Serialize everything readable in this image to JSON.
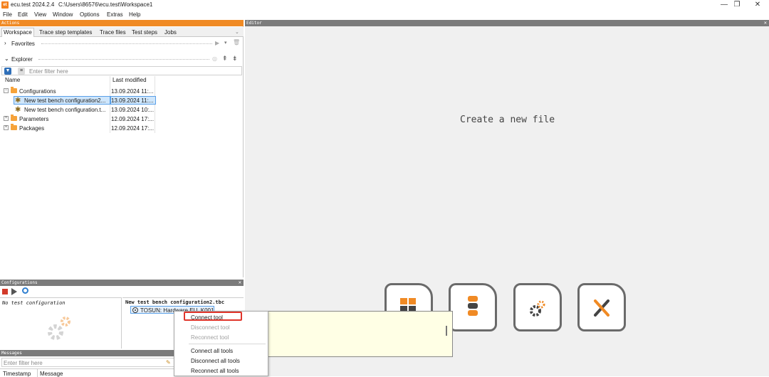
{
  "titlebar": {
    "app_icon": "et",
    "title": "ecu.test 2024.2.4",
    "path": "C:\\Users\\86576\\ecu.test\\Workspace1",
    "controls": {
      "minimize": "—",
      "maximize": "❐",
      "close": "✕"
    }
  },
  "menubar": {
    "items": [
      {
        "label": "File"
      },
      {
        "label": "Edit"
      },
      {
        "label": "View"
      },
      {
        "label": "Window"
      },
      {
        "label": "Options"
      },
      {
        "label": "Extras"
      },
      {
        "label": "Help"
      }
    ]
  },
  "actions_panel": {
    "title": "Actions",
    "tabs": [
      {
        "label": "Workspace"
      },
      {
        "label": "Trace step templates"
      },
      {
        "label": "Trace files"
      },
      {
        "label": "Test steps"
      },
      {
        "label": "Jobs"
      }
    ],
    "favorites_label": "Favorites",
    "explorer_label": "Explorer",
    "filter_placeholder": "Enter filter here",
    "columns": {
      "name": "Name",
      "modified": "Last modified"
    },
    "tree": [
      {
        "name": "Configurations",
        "date": "13.09.2024 11:..."
      },
      {
        "name": "New test bench configuration2...",
        "date": "13.09.2024 11:..."
      },
      {
        "name": "New test bench configuration.t...",
        "date": "13.09.2024 10:..."
      },
      {
        "name": "Parameters",
        "date": "12.09.2024 17:..."
      },
      {
        "name": "Packages",
        "date": "12.09.2024 17:..."
      }
    ]
  },
  "editor": {
    "title": "Editor",
    "empty_text": "Create a new file"
  },
  "configurations_panel": {
    "title": "Configurations",
    "no_config": "No test configuration",
    "bench_title": "New test bench configuration2.tbc",
    "tool_entry": "TOSUN: Hardware EU_K001"
  },
  "messages_panel": {
    "title": "Messages",
    "filter_placeholder": "Enter filter here",
    "columns": {
      "timestamp": "Timestamp",
      "message": "Message"
    }
  },
  "context_menu": {
    "items": [
      {
        "label": "Connect tool",
        "enabled": true
      },
      {
        "label": "Disconnect tool",
        "enabled": false
      },
      {
        "label": "Reconnect tool",
        "enabled": false
      },
      {
        "label": "Connect all tools",
        "enabled": true
      },
      {
        "label": "Disconnect all tools",
        "enabled": true
      },
      {
        "label": "Reconnect all tools",
        "enabled": true
      }
    ]
  },
  "colors": {
    "accent": "#f08a24",
    "panel_header": "#7b7b7b",
    "highlight": "#e0352b",
    "selection": "#cfe6fb"
  }
}
